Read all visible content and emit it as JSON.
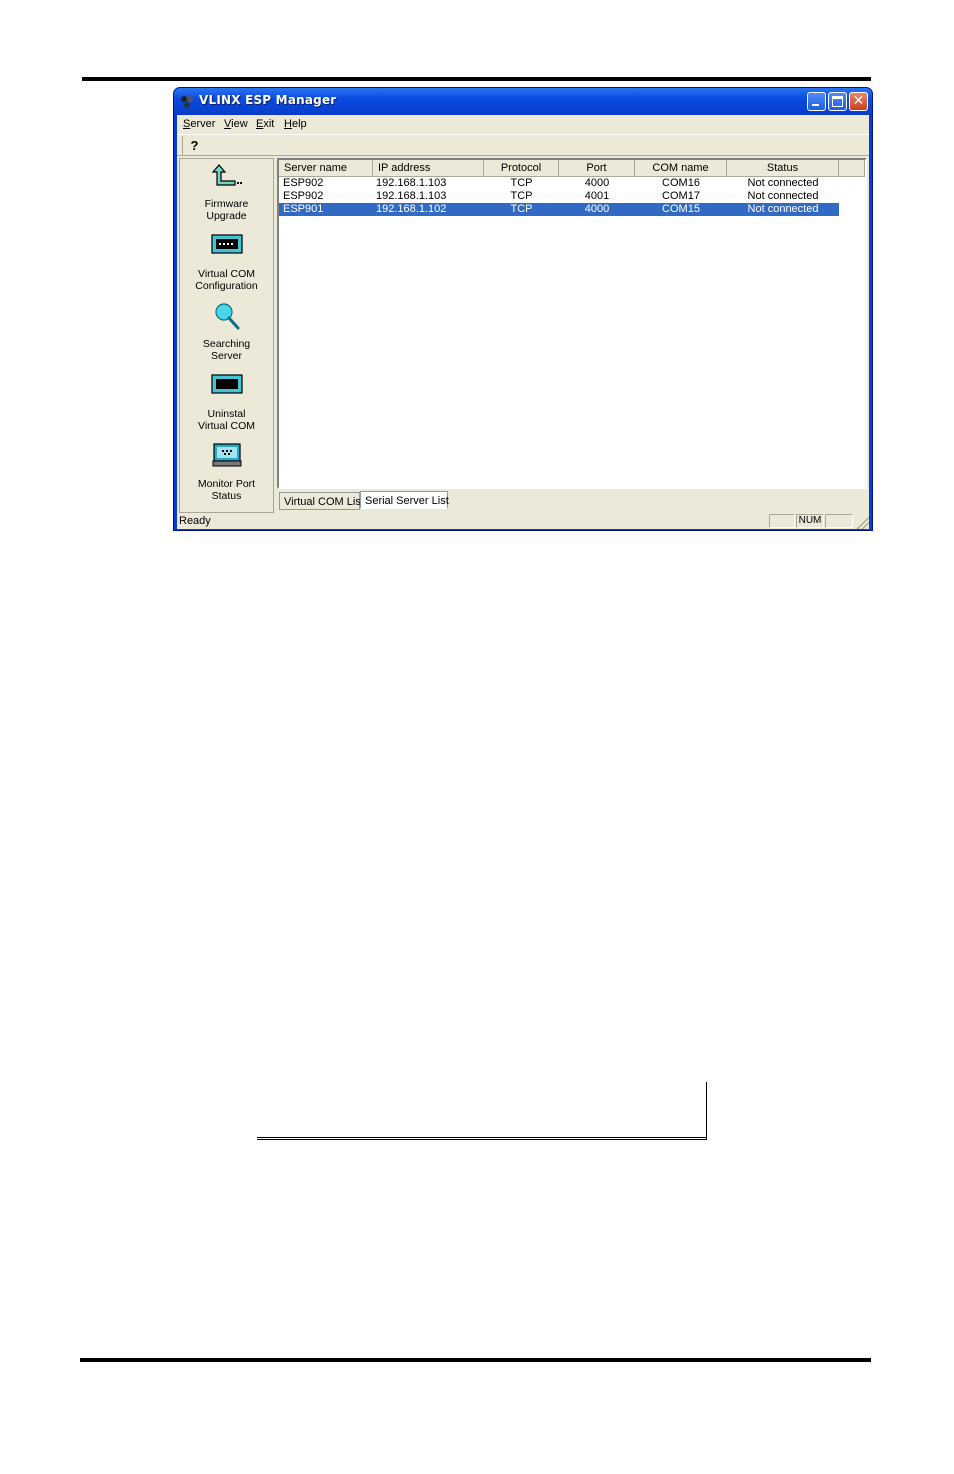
{
  "window": {
    "title": "VLINX ESP Manager"
  },
  "menu": [
    "Server",
    "View",
    "Exit",
    "Help"
  ],
  "toolbar": {
    "help_icon": "?"
  },
  "iconbar": [
    {
      "icon": "firmware-upgrade-icon",
      "label1": "Firmware",
      "label2": "Upgrade"
    },
    {
      "icon": "virtual-com-configuration-icon",
      "label1": "Virtual COM",
      "label2": "Configuration"
    },
    {
      "icon": "searching-server-icon",
      "label1": "Searching",
      "label2": "Server"
    },
    {
      "icon": "uninstal-virtual-com-icon",
      "label1": "Uninstal",
      "label2": "Virtual COM"
    },
    {
      "icon": "monitor-port-status-icon",
      "label1": "Monitor Port",
      "label2": "Status"
    }
  ],
  "list": {
    "columns": [
      "Server name",
      "IP address",
      "Protocol",
      "Port",
      "COM name",
      "Status"
    ],
    "rows": [
      [
        "ESP902",
        "192.168.1.103",
        "TCP",
        "4000",
        "COM16",
        "Not connected"
      ],
      [
        "ESP902",
        "192.168.1.103",
        "TCP",
        "4001",
        "COM17",
        "Not connected"
      ],
      [
        "ESP901",
        "192.168.1.102",
        "TCP",
        "4000",
        "COM15",
        "Not connected"
      ]
    ],
    "selected_row": 2
  },
  "tabs": [
    "Virtual COM List",
    "Serial Server List"
  ],
  "active_tab": 1,
  "statusbar": {
    "text": "Ready",
    "num": "NUM"
  },
  "colors": {
    "titlebar": "#0a4bdf",
    "selection": "#316ac5",
    "face": "#ece9d8"
  }
}
